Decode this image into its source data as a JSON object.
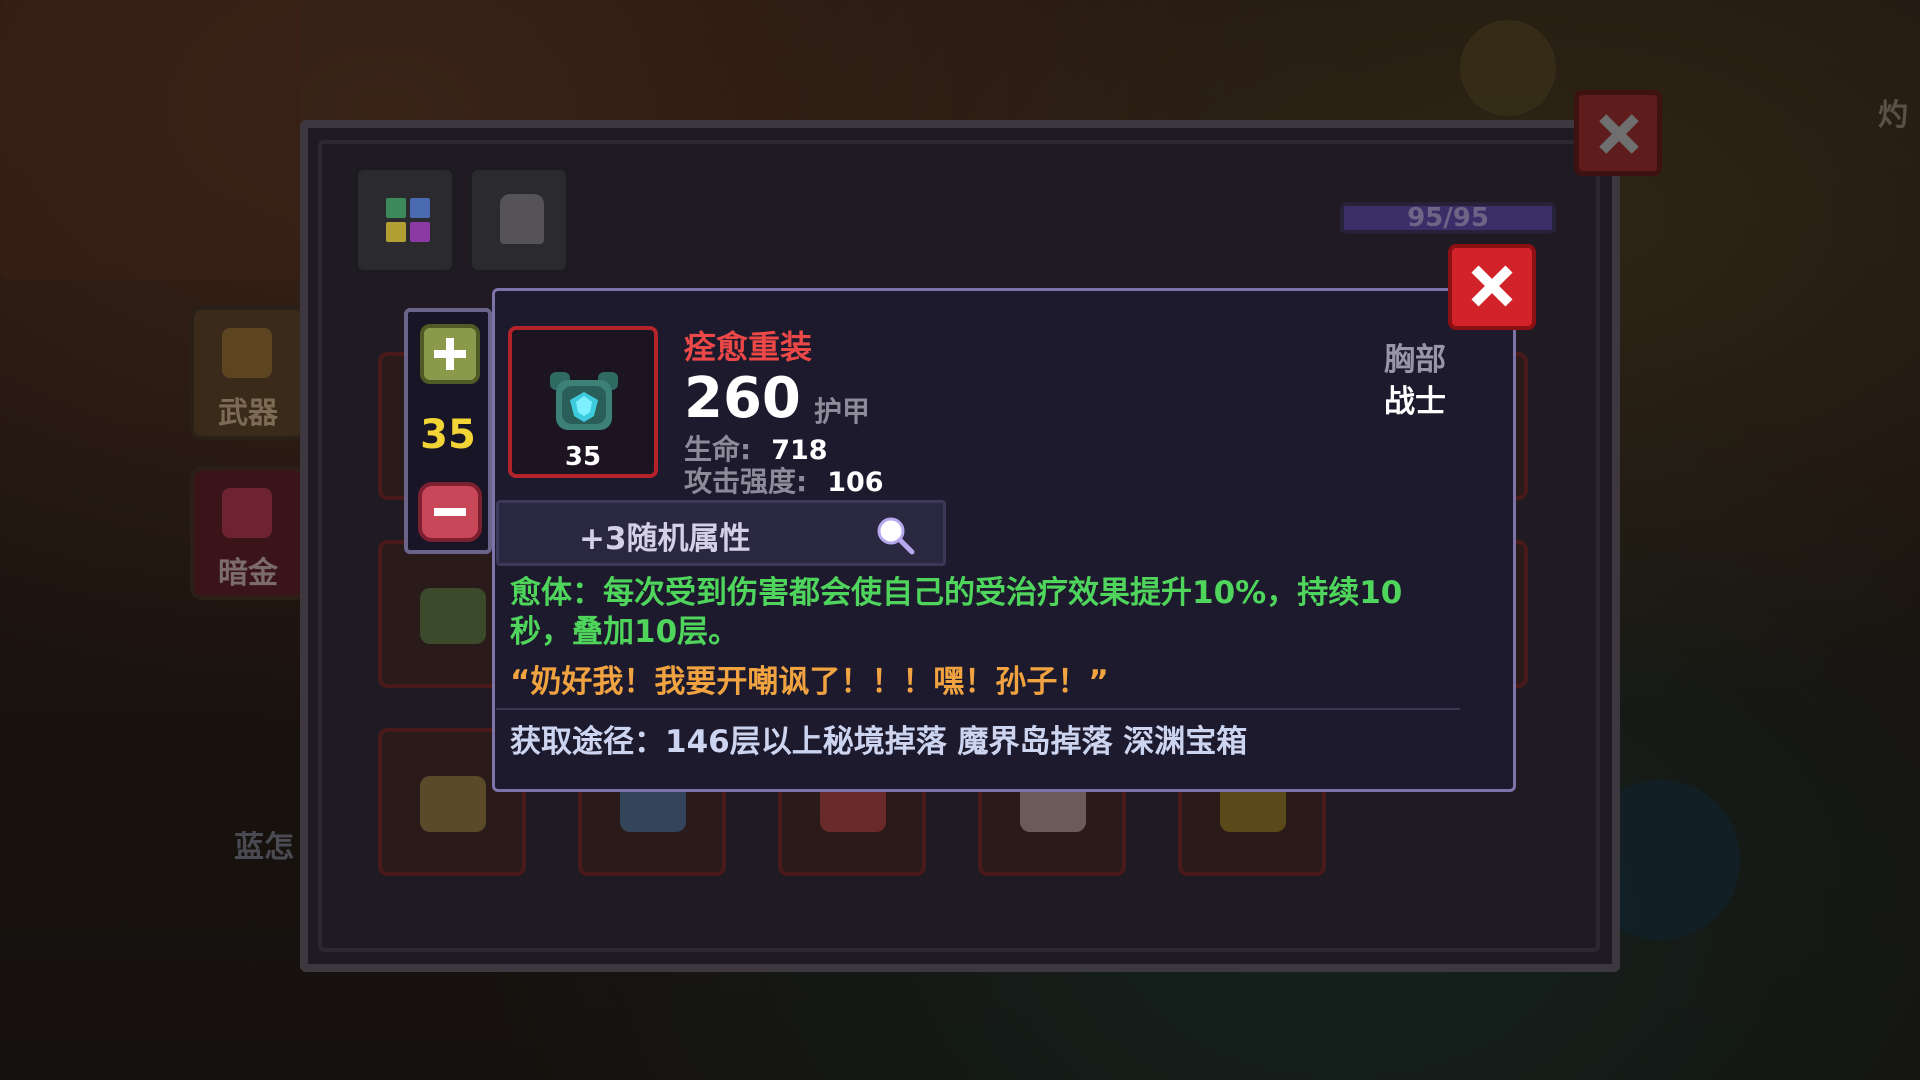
{
  "sidebar": {
    "weapon_label": "武器",
    "dark_gold_label": "暗金",
    "partial_label": "蓝怎"
  },
  "header_partial": "灼",
  "inventory": {
    "capacity": "95/95"
  },
  "stepper": {
    "value": "35"
  },
  "tooltip": {
    "item_name": "痊愈重装",
    "item_level": "35",
    "armor_value": "260",
    "armor_label": "护甲",
    "stats": [
      {
        "label": "生命:",
        "value": "718"
      },
      {
        "label": "攻击强度:",
        "value": "106"
      }
    ],
    "slot_type": "胸部",
    "class_type": "战士",
    "random_attr_label": "+3随机属性",
    "passive_line1": "愈体：每次受到伤害都会使自己的受治疗效果提升10%，持续10",
    "passive_line2": "秒，叠加10层。",
    "quote": "“奶好我！我要开嘲讽了！！！嘿！孙子！”",
    "source": "获取途径：146层以上秘境掉落 魔界岛掉落 深渊宝箱"
  },
  "colors": {
    "item_name": "#ec4848",
    "passive": "#4fd45c",
    "quote": "#f0a340",
    "stepper_value": "#f2d436",
    "close_button": "#d2222a"
  }
}
